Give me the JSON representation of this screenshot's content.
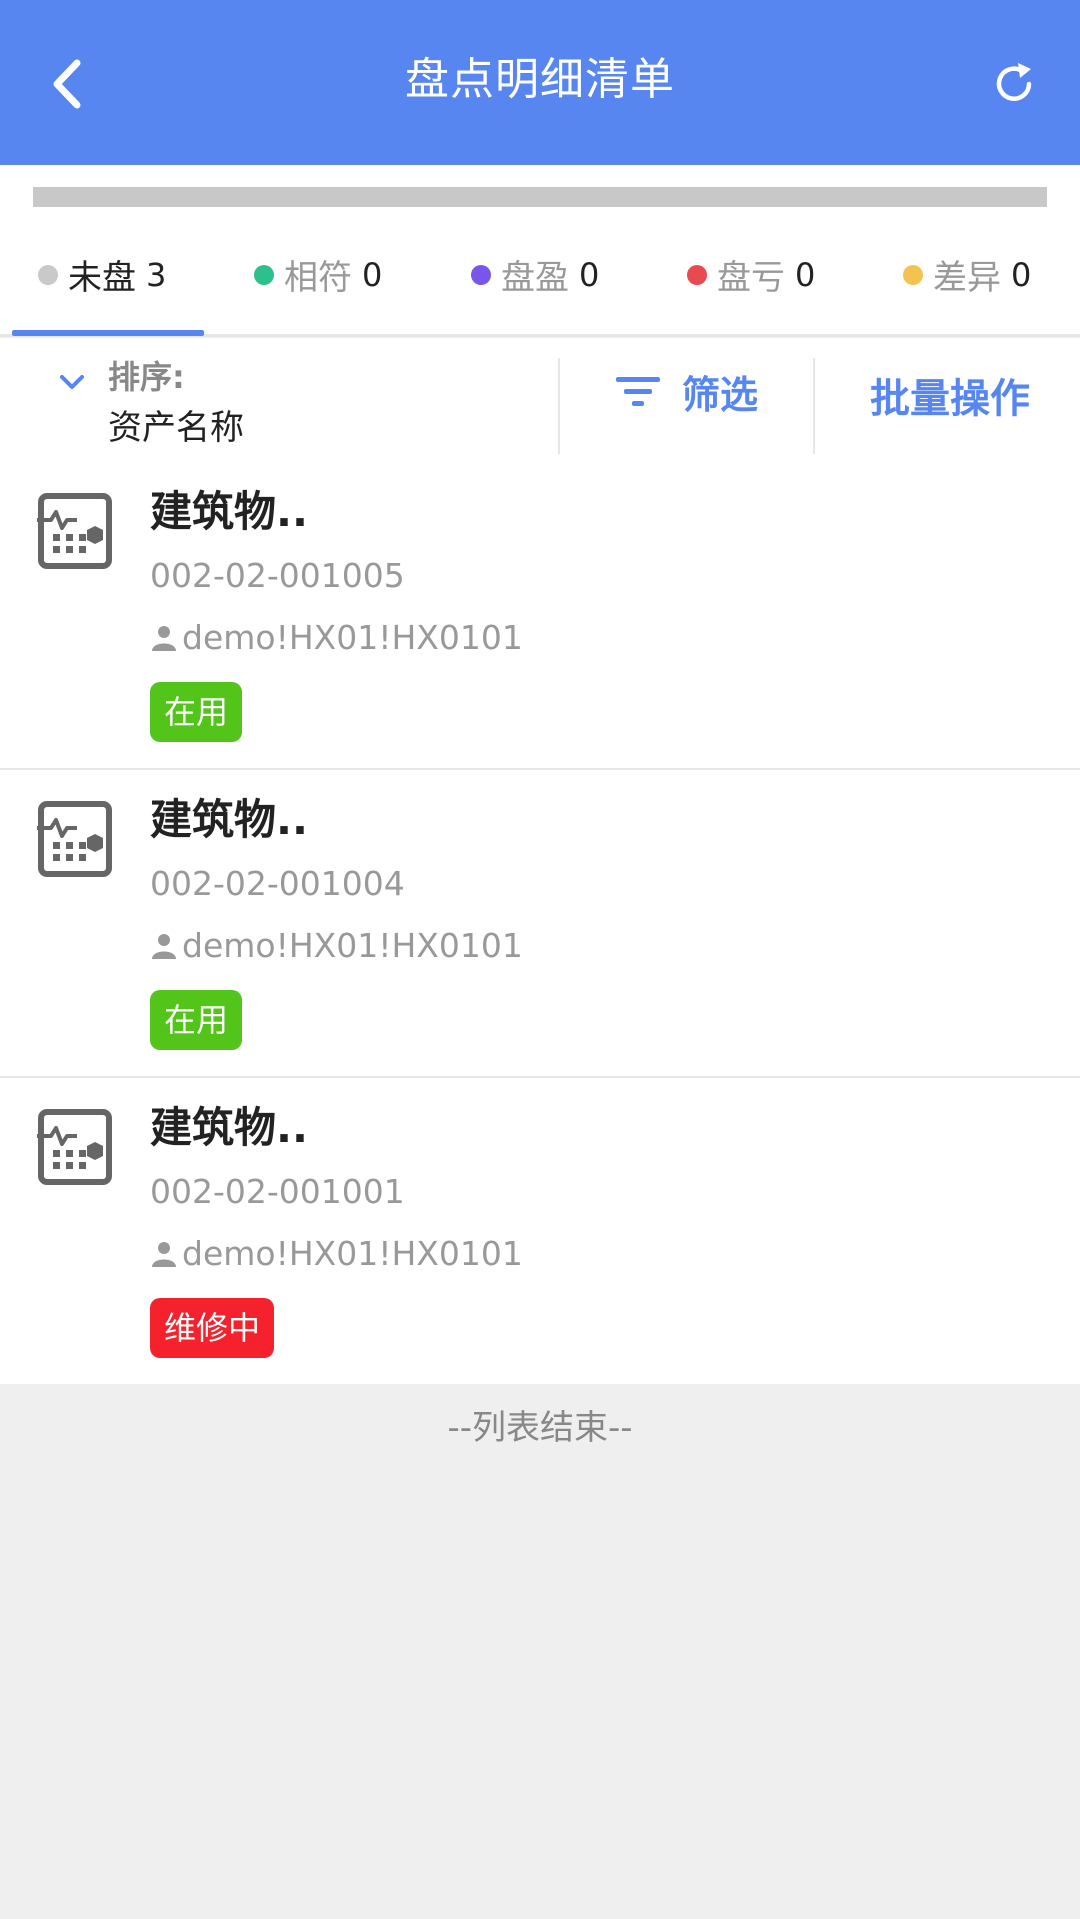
{
  "header": {
    "title": "盘点明细清单",
    "back_icon": "chevron-left-icon",
    "refresh_icon": "refresh-icon",
    "background": "#5786f0"
  },
  "progress": {
    "value": 0
  },
  "tabs": [
    {
      "label": "未盘",
      "count": "3",
      "dot_color": "#c9c9c9",
      "active": true
    },
    {
      "label": "相符",
      "count": "0",
      "dot_color": "#2cc08c",
      "active": false
    },
    {
      "label": "盘盈",
      "count": "0",
      "dot_color": "#7a55ea",
      "active": false
    },
    {
      "label": "盘亏",
      "count": "0",
      "dot_color": "#e84a4f",
      "active": false
    },
    {
      "label": "差异",
      "count": "0",
      "dot_color": "#f3c24f",
      "active": false
    }
  ],
  "toolbar": {
    "sort_label": "排序:",
    "sort_value": "资产名称",
    "filter_label": "筛选",
    "batch_label": "批量操作",
    "accent": "#5786f0"
  },
  "items": [
    {
      "name": "建筑物..",
      "code": "002-02-001005",
      "owner": "demo!HX01!HX0101",
      "status": "在用",
      "status_color": "#52c41a"
    },
    {
      "name": "建筑物..",
      "code": "002-02-001004",
      "owner": "demo!HX01!HX0101",
      "status": "在用",
      "status_color": "#52c41a"
    },
    {
      "name": "建筑物..",
      "code": "002-02-001001",
      "owner": "demo!HX01!HX0101",
      "status": "维修中",
      "status_color": "#f5222d"
    }
  ],
  "list_end": "--列表结束--"
}
